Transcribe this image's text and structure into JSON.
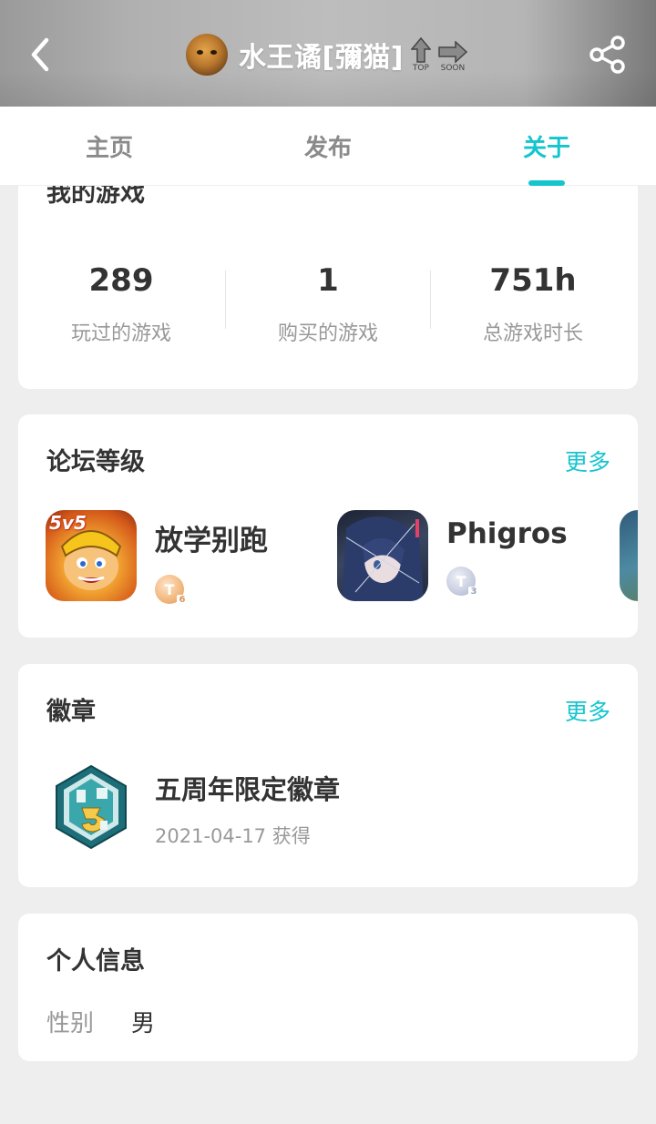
{
  "header": {
    "back_icon": "chevron-left-icon",
    "username": "水王谲[彌猫]",
    "badges": [
      {
        "icon": "arrow-up-icon",
        "caption": "TOP"
      },
      {
        "icon": "arrow-right-icon",
        "caption": "SOON"
      }
    ],
    "share_icon": "share-icon"
  },
  "tabs": [
    {
      "label": "主页",
      "active": false
    },
    {
      "label": "发布",
      "active": false
    },
    {
      "label": "关于",
      "active": true
    }
  ],
  "colors": {
    "accent": "#15c5ce"
  },
  "my_games": {
    "title": "我的游戏",
    "stats": [
      {
        "value": "289",
        "label": "玩过的游戏"
      },
      {
        "value": "1",
        "label": "购买的游戏"
      },
      {
        "value": "751h",
        "label": "总游戏时长"
      }
    ]
  },
  "forum": {
    "title": "论坛等级",
    "more": "更多",
    "games": [
      {
        "name": "放学别跑",
        "icon_text": "5v5",
        "level": "T",
        "level_num": "6"
      },
      {
        "name": "Phigros",
        "level": "T",
        "level_num": "3"
      }
    ]
  },
  "medals": {
    "title": "徽章",
    "more": "更多",
    "items": [
      {
        "name": "五周年限定徽章",
        "date": "2021-04-17 获得"
      }
    ]
  },
  "personal": {
    "title": "个人信息",
    "fields": [
      {
        "label": "性别",
        "value": "男"
      }
    ]
  }
}
